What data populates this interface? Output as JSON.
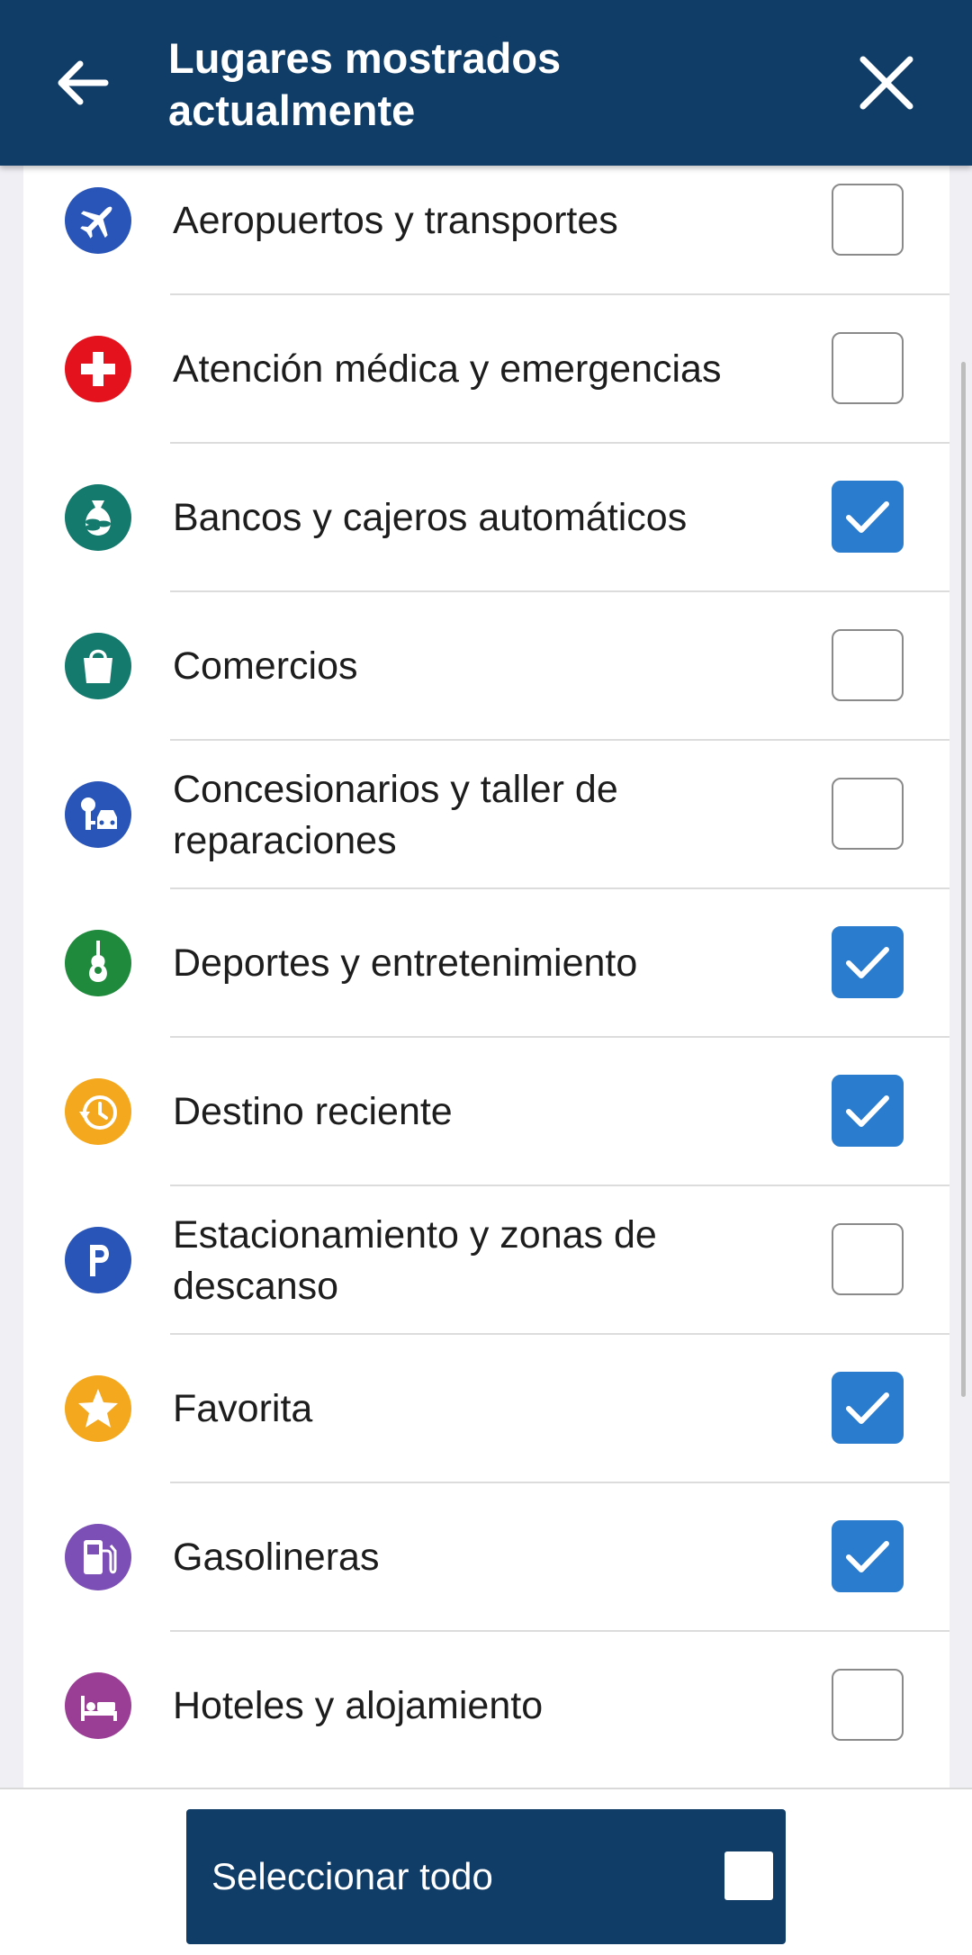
{
  "header": {
    "title": "Lugares mostrados actualmente",
    "back_icon": "arrow-left-icon",
    "close_icon": "close-icon"
  },
  "categories": [
    {
      "label": "Aeropuertos y transportes",
      "icon": "airplane-icon",
      "color": "#2a55b8",
      "checked": false
    },
    {
      "label": "Atención médica y emergencias",
      "icon": "medical-cross-icon",
      "color": "#e4121c",
      "checked": false
    },
    {
      "label": "Bancos y cajeros automáticos",
      "icon": "money-bag-icon",
      "color": "#137a6d",
      "checked": true
    },
    {
      "label": "Comercios",
      "icon": "shopping-bag-icon",
      "color": "#137a6d",
      "checked": false
    },
    {
      "label": "Concesionarios y taller de reparaciones",
      "icon": "car-key-icon",
      "color": "#2a55b8",
      "checked": false
    },
    {
      "label": "Deportes y entretenimiento",
      "icon": "guitar-icon",
      "color": "#1f8a3c",
      "checked": true
    },
    {
      "label": "Destino reciente",
      "icon": "history-clock-icon",
      "color": "#f4a81d",
      "checked": true
    },
    {
      "label": "Estacionamiento y zonas de descanso",
      "icon": "parking-icon",
      "color": "#2a55b8",
      "checked": false
    },
    {
      "label": "Favorita",
      "icon": "star-icon",
      "color": "#f4a81d",
      "checked": true
    },
    {
      "label": "Gasolineras",
      "icon": "fuel-pump-icon",
      "color": "#7b4fb5",
      "checked": true
    },
    {
      "label": "Hoteles y alojamiento",
      "icon": "bed-icon",
      "color": "#9a3d94",
      "checked": false
    }
  ],
  "footer": {
    "select_all_label": "Seleccionar todo",
    "select_all_checked": false
  },
  "colors": {
    "header_bg": "#0f3d68",
    "checkbox_checked": "#2a7dce"
  }
}
